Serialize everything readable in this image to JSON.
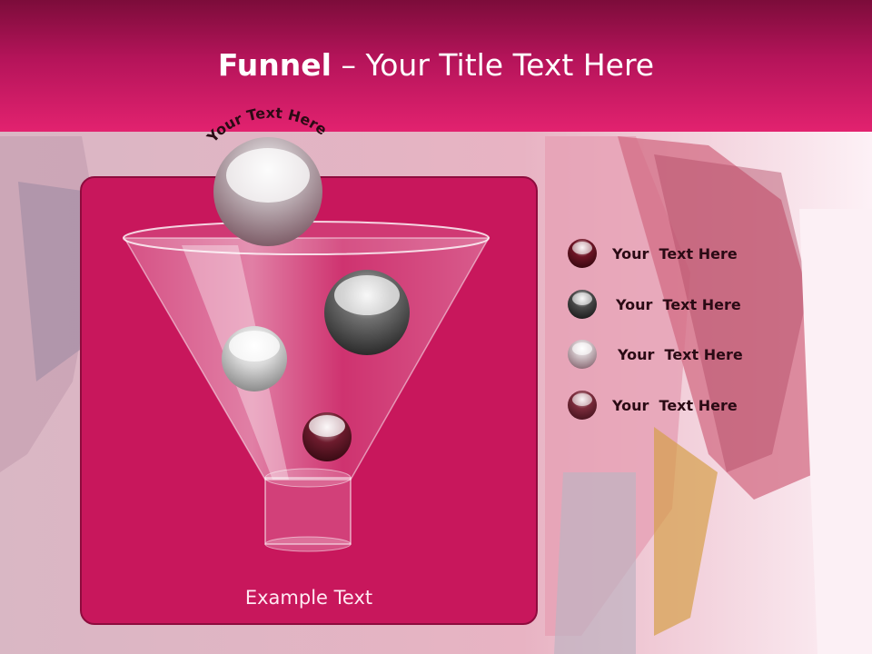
{
  "header": {
    "title_bold": "Funnel",
    "title_rest": " – Your Title Text Here"
  },
  "funnel": {
    "arc_text": "Your Text Here",
    "footer": "Example Text"
  },
  "legend": [
    {
      "label": "Your  Text Here",
      "color": "#6e1526"
    },
    {
      "label": "Your  Text Here",
      "color": "#4a4a4a"
    },
    {
      "label": "Your  Text Here",
      "color": "#a99a9f"
    },
    {
      "label": "Your  Text Here",
      "color": "#7b2c3c"
    }
  ],
  "colors": {
    "header_top": "#7c0c3a",
    "header_bottom": "#e2226f",
    "panel": "#c8175c",
    "background": "#fbe9f1"
  }
}
